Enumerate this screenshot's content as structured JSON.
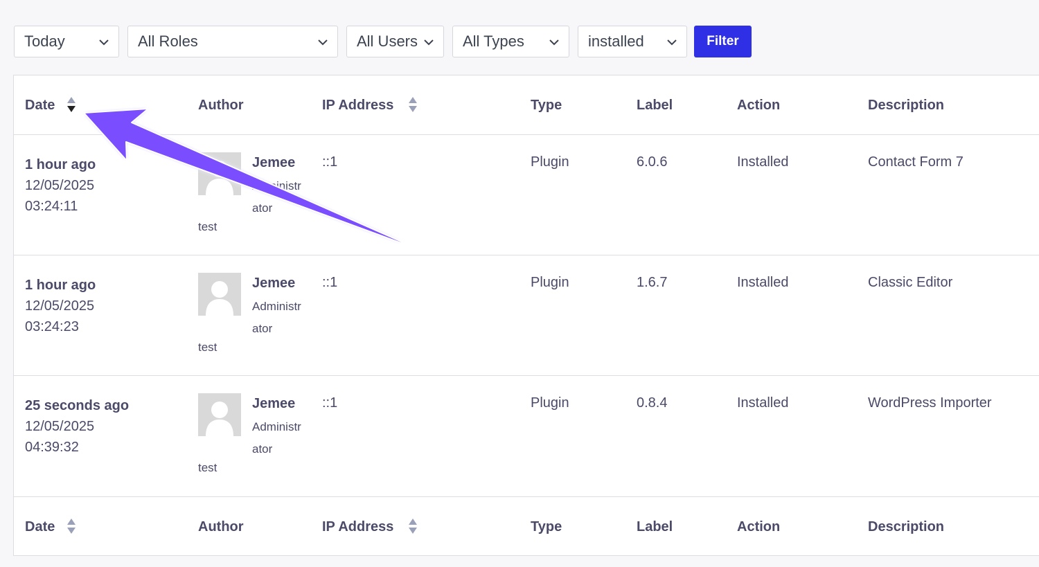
{
  "filters": {
    "date_range": "Today",
    "roles": "All Roles",
    "users": "All Users",
    "types": "All Types",
    "action": "installed",
    "filter_label": "Filter"
  },
  "columns": {
    "date": "Date",
    "author": "Author",
    "ip": "IP Address",
    "type": "Type",
    "label": "Label",
    "action": "Action",
    "description": "Description"
  },
  "rows": [
    {
      "relative": "1 hour ago",
      "date": "12/05/2025",
      "time": "03:24:11",
      "author_name": "Jemee",
      "author_role": "Administrator",
      "author_login": "test",
      "ip": "::1",
      "type": "Plugin",
      "label": "6.0.6",
      "action": "Installed",
      "description": "Contact Form 7"
    },
    {
      "relative": "1 hour ago",
      "date": "12/05/2025",
      "time": "03:24:23",
      "author_name": "Jemee",
      "author_role": "Administrator",
      "author_login": "test",
      "ip": "::1",
      "type": "Plugin",
      "label": "1.6.7",
      "action": "Installed",
      "description": "Classic Editor"
    },
    {
      "relative": "25 seconds ago",
      "date": "12/05/2025",
      "time": "04:39:32",
      "author_name": "Jemee",
      "author_role": "Administrator",
      "author_login": "test",
      "ip": "::1",
      "type": "Plugin",
      "label": "0.8.4",
      "action": "Installed",
      "description": "WordPress Importer"
    }
  ],
  "colors": {
    "accent": "#2f2fe6",
    "annotation_arrow": "#7a4dff"
  }
}
